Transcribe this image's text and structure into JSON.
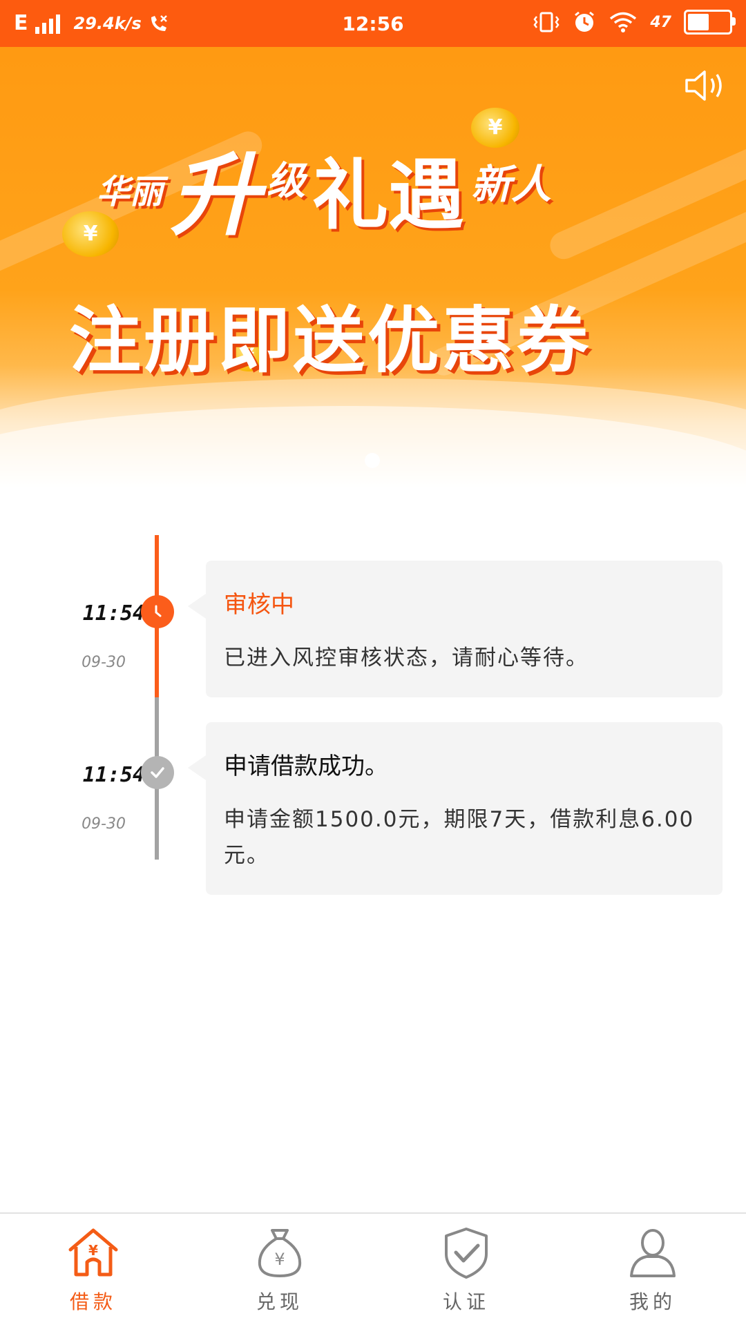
{
  "status_bar": {
    "network": "E",
    "speed": "29.4k/s",
    "time": "12:56",
    "battery_percent": "47",
    "battery_level": 0.45
  },
  "banner": {
    "line1": {
      "a": "华丽",
      "b": "升",
      "c": "级",
      "d": "礼遇",
      "e": "新人"
    },
    "line2": "注册即送优惠券",
    "coin_symbol": "¥",
    "accent_color": "#ff9a12"
  },
  "timeline": {
    "items": [
      {
        "time": "11:54",
        "date": "09-30",
        "title": "审核中",
        "desc": "已进入风控审核状态，请耐心等待。",
        "state": "in-progress"
      },
      {
        "time": "11:54",
        "date": "09-30",
        "title": "申请借款成功。",
        "desc": "申请金额1500.0元，期限7天，借款利息6.00元。",
        "state": "done"
      }
    ]
  },
  "bottom_nav": {
    "items": [
      {
        "label": "借款",
        "icon": "loan-house-icon",
        "active": true
      },
      {
        "label": "兑现",
        "icon": "money-bag-icon",
        "active": false
      },
      {
        "label": "认证",
        "icon": "shield-check-icon",
        "active": false
      },
      {
        "label": "我的",
        "icon": "person-icon",
        "active": false
      }
    ]
  },
  "colors": {
    "brand": "#fd5b0f",
    "gray": "#a3a3a3"
  }
}
